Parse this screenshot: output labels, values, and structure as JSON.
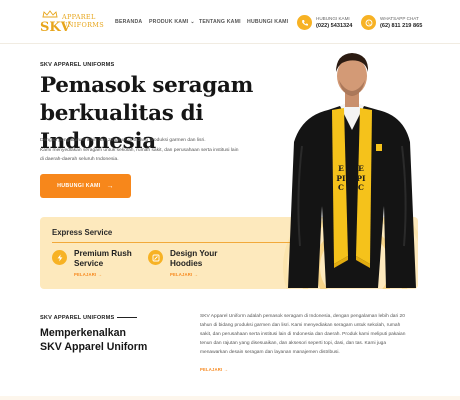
{
  "brand": {
    "logo_mark": "SKV",
    "logo_line1": "APPAREL",
    "logo_line2": "UNIFORMS"
  },
  "nav": {
    "items": [
      {
        "label": "BERANDA",
        "active": true
      },
      {
        "label": "PRODUK KAMI",
        "has_dropdown": true
      },
      {
        "label": "TENTANG KAMI"
      },
      {
        "label": "HUBUNGI KAMI"
      }
    ]
  },
  "contacts": [
    {
      "label": "HUBUNGI KAMI",
      "value": "(022) 5431324",
      "icon": "phone-icon"
    },
    {
      "label": "WHATSAPP CHAT",
      "value": "(62) 811 219 865",
      "icon": "whatsapp-icon"
    }
  ],
  "hero": {
    "eyebrow": "SKV APPAREL UNIFORMS",
    "title_line1": "Pemasok seragam",
    "title_line2": "berkualitas di Indonesia",
    "desc_line1": "Dengan pengalaman lebih dari 20 tahun di bidang produksi garmen dan lisri.",
    "desc_line2": "Kami menyediakan seragam untuk sekolah, rumah sakit, dan perusahaan serta institusi lain",
    "desc_line3": "di daerah-daerah seluruh Indonesia.",
    "cta_label": "HUBUNGI KAMI",
    "image_text": "EPIC"
  },
  "express": {
    "title": "Express Service",
    "services": [
      {
        "name": "Premium Rush Service",
        "link": "PELAJARI",
        "icon": "bolt-icon"
      },
      {
        "name": "Design Your Hoodies",
        "link": "PELAJARI",
        "icon": "design-icon"
      }
    ]
  },
  "about": {
    "eyebrow": "SKV APPAREL UNIFORMS",
    "title_line1": "Memperkenalkan",
    "title_line2": "SKV Apparel Uniform",
    "text_lines": [
      "SKV Apparel Uniform adalah pemasok seragam di Indonesia, dengan pengalaman lebih dari 20",
      "tahun di bidang produksi garmen dan lisri. Kami menyediakan seragam untuk sekolah, rumah",
      "sakit, dan perusahaan serta institusi lain di Indonesia dan daerah. Produk kami meliputi pakaian",
      "tenun dan rajutan yang disesuaikan, dan aksesori seperti topi, dasi, dan tas. Kami juga",
      "menawarkan desain seragam dan layanan manajemen distribusi."
    ],
    "link": "PELAJARI"
  },
  "colors": {
    "accent": "#f7871b",
    "gold": "#f7b224",
    "card": "#fde9bd"
  }
}
